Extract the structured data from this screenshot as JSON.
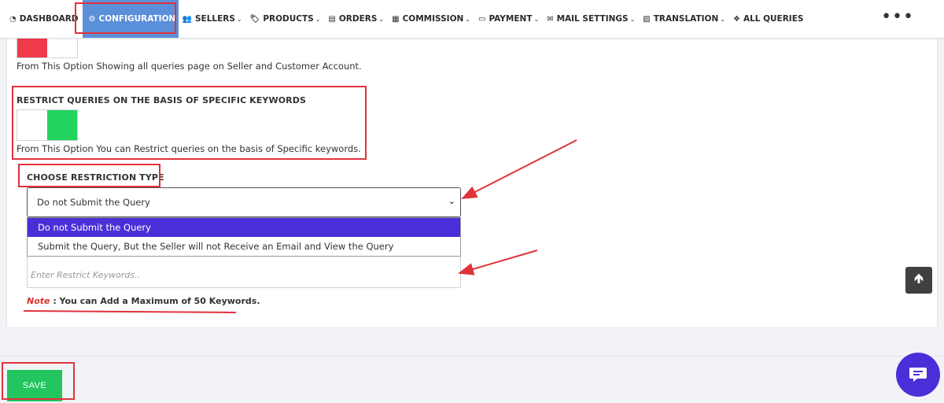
{
  "nav": {
    "items": [
      {
        "label": "DASHBOARD",
        "icon": "dashboard-icon",
        "glyph": "◔",
        "chevron": ""
      },
      {
        "label": "CONFIGURATION",
        "icon": "gear-icon",
        "glyph": "⚙",
        "chevron": "⌄"
      },
      {
        "label": "SELLERS",
        "icon": "users-icon",
        "glyph": "👥",
        "chevron": "⌄"
      },
      {
        "label": "PRODUCTS",
        "icon": "tag-icon",
        "glyph": "🏷",
        "chevron": "⌄"
      },
      {
        "label": "ORDERS",
        "icon": "clipboard-icon",
        "glyph": "▤",
        "chevron": "⌄"
      },
      {
        "label": "COMMISSION",
        "icon": "store-icon",
        "glyph": "▦",
        "chevron": "⌄"
      },
      {
        "label": "PAYMENT",
        "icon": "card-icon",
        "glyph": "▭",
        "chevron": "⌄"
      },
      {
        "label": "MAIL SETTINGS",
        "icon": "mail-icon",
        "glyph": "✉",
        "chevron": "⌄"
      },
      {
        "label": "TRANSLATION",
        "icon": "language-icon",
        "glyph": "▨",
        "chevron": "⌄"
      },
      {
        "label": "ALL QUERIES",
        "icon": "queries-icon",
        "glyph": "❖",
        "chevron": ""
      }
    ],
    "more": "•••"
  },
  "queries_page": {
    "description": "From This Option Showing all queries page on Seller and Customer Account."
  },
  "restrict": {
    "label": "RESTRICT QUERIES ON THE BASIS OF SPECIFIC KEYWORDS",
    "enabled": true,
    "description": "From This Option You can Restrict queries on the basis of Specific keywords."
  },
  "restriction_type": {
    "label": "CHOOSE RESTRICTION TYPE",
    "selected": "Do not Submit the Query",
    "options": [
      "Do not Submit the Query",
      "Submit the Query, But the Seller will not Receive an Email and View the Query"
    ]
  },
  "keywords": {
    "placeholder": "Enter Restrict Keywords.."
  },
  "note": {
    "prefix": "Note",
    "text": " : You can Add a Maximum of 50 Keywords."
  },
  "save_label": "SAVE",
  "colors": {
    "active_nav": "#5b8fd9",
    "toggle_on": "#22d35e",
    "toggle_off_red": "#ef3b4a",
    "dropdown_selected": "#4a2fd8",
    "save": "#22c55e",
    "annotation": "#e0333b"
  }
}
